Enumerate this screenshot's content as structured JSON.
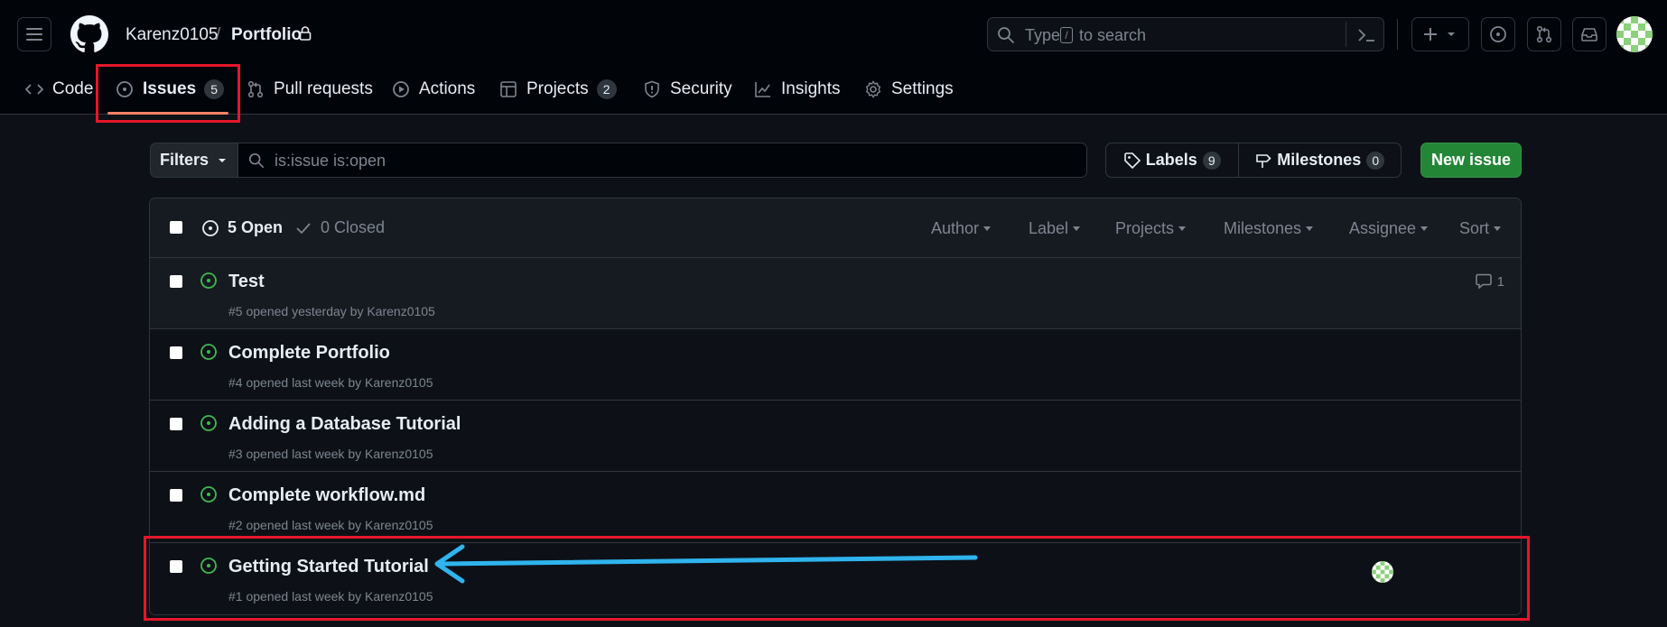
{
  "header": {
    "owner": "Karenz0105",
    "separator": "/",
    "repo": "Portfolio",
    "search": {
      "prefix": "Type",
      "key": "/",
      "suffix": "to search"
    }
  },
  "tabs": [
    {
      "label": "Code",
      "icon": "code-icon"
    },
    {
      "label": "Issues",
      "count": "5",
      "icon": "issue-opened-icon",
      "selected": true
    },
    {
      "label": "Pull requests",
      "icon": "git-pull-request-icon"
    },
    {
      "label": "Actions",
      "icon": "play-icon"
    },
    {
      "label": "Projects",
      "count": "2",
      "icon": "table-icon"
    },
    {
      "label": "Security",
      "icon": "shield-icon"
    },
    {
      "label": "Insights",
      "icon": "graph-icon"
    },
    {
      "label": "Settings",
      "icon": "gear-icon"
    }
  ],
  "toolbar": {
    "filters_label": "Filters",
    "search_placeholder": "is:issue is:open",
    "labels_label": "Labels",
    "labels_count": "9",
    "milestones_label": "Milestones",
    "milestones_count": "0",
    "new_issue_label": "New issue"
  },
  "list_header": {
    "open_label": "5 Open",
    "closed_label": "0 Closed",
    "filters": [
      "Author",
      "Label",
      "Projects",
      "Milestones",
      "Assignee",
      "Sort"
    ]
  },
  "issues": [
    {
      "title": "Test",
      "meta": "#5 opened yesterday by Karenz0105",
      "comments": "1"
    },
    {
      "title": "Complete Portfolio",
      "meta": "#4 opened last week by Karenz0105"
    },
    {
      "title": "Adding a Database Tutorial",
      "meta": "#3 opened last week by Karenz0105"
    },
    {
      "title": "Complete workflow.md",
      "meta": "#2 opened last week by Karenz0105"
    },
    {
      "title": "Getting Started Tutorial",
      "meta": "#1 opened last week by Karenz0105",
      "assignee": "Karenz0105"
    }
  ],
  "colors": {
    "background": "#0d1117",
    "header_bg": "#010409",
    "open_green": "#3fb950",
    "new_issue_green": "#238636",
    "tab_underline": "#f78166",
    "annotation_red": "#e5172b",
    "annotation_arrow": "#2fb4ee"
  }
}
